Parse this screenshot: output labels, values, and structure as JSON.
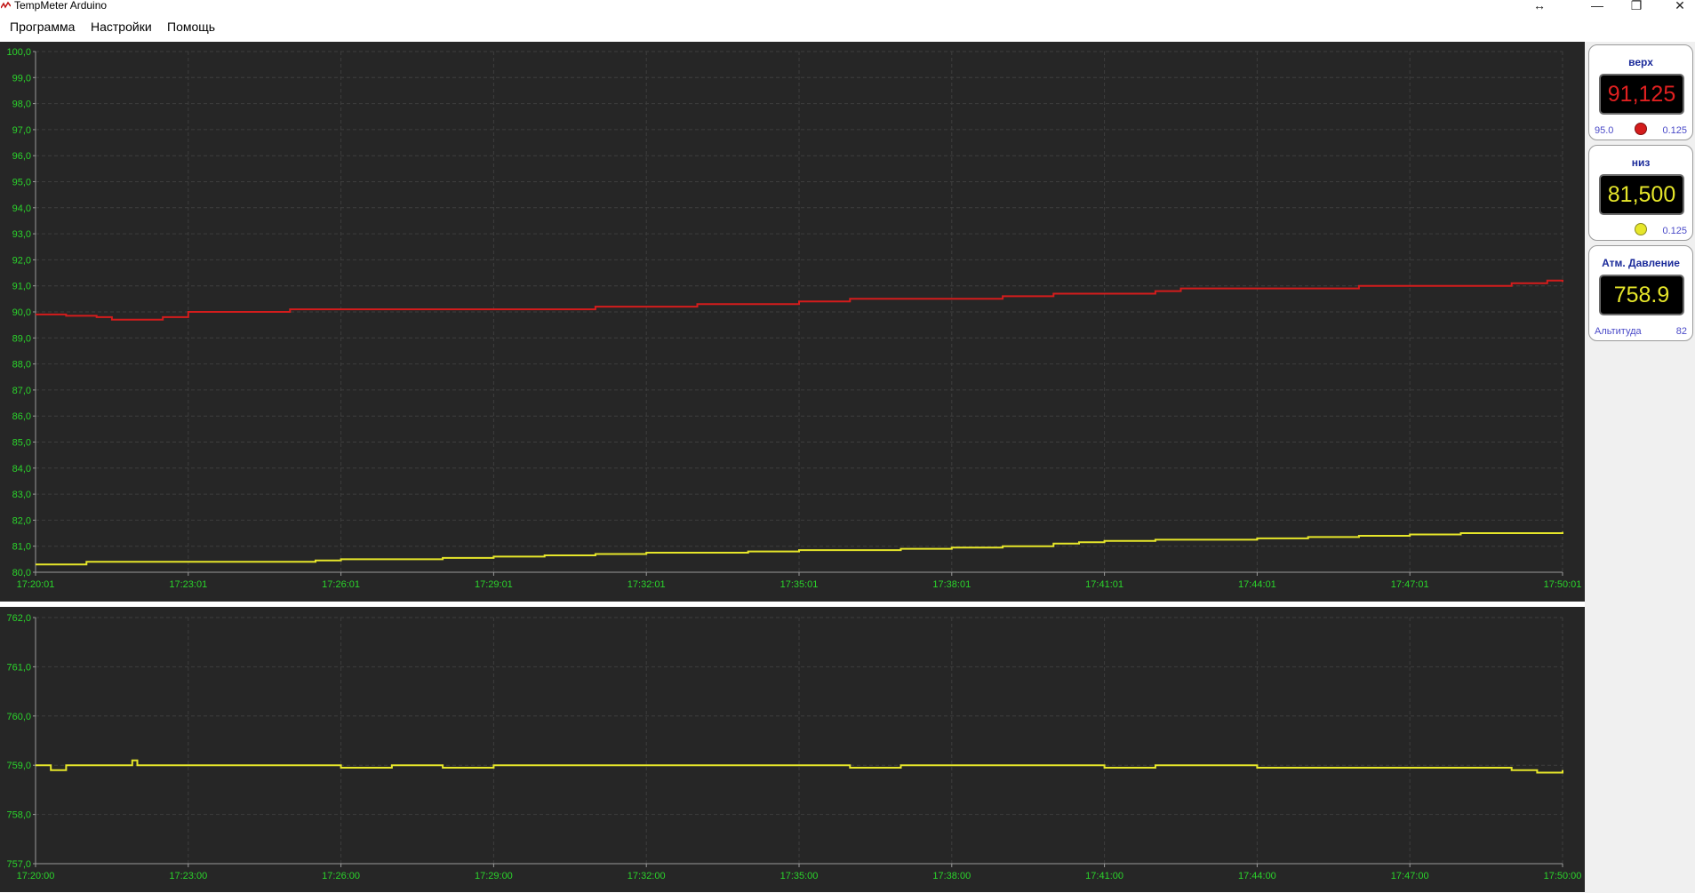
{
  "window": {
    "title": "TempMeter Arduino",
    "buttons": [
      "↔",
      "—",
      "❐",
      "✕"
    ]
  },
  "menu": [
    {
      "label": "Программа"
    },
    {
      "label": "Настройки"
    },
    {
      "label": "Помощь"
    }
  ],
  "colors": {
    "plot_bg": "#262626",
    "grid": "#3e3e3e",
    "axis_text": "#2bd42b",
    "upper_series": "#d41c1c",
    "lower_series": "#e6e62a"
  },
  "gauges": {
    "upper": {
      "title": "верх",
      "value": "91,125",
      "left": "95.0",
      "right": "0.125",
      "color": "#e02020",
      "dot": "#d41c1c"
    },
    "lower": {
      "title": "низ",
      "value": "81,500",
      "left": "",
      "right": "0.125",
      "color": "#e6e62a",
      "dot": "#e6e62a"
    },
    "pressure": {
      "title": "Атм. Давление",
      "value": "758.9",
      "left": "Альтитуда",
      "right": "82",
      "color": "#e6e62a"
    }
  },
  "chart_data": [
    {
      "type": "line",
      "ylim": [
        80,
        100
      ],
      "yticks": [
        "100,0",
        "99,0",
        "98,0",
        "97,0",
        "96,0",
        "95,0",
        "94,0",
        "93,0",
        "92,0",
        "91,0",
        "90,0",
        "89,0",
        "88,0",
        "87,0",
        "86,0",
        "85,0",
        "84,0",
        "83,0",
        "82,0",
        "81,0",
        "80,0"
      ],
      "xticks": [
        "17:20:01",
        "17:23:01",
        "17:26:01",
        "17:29:01",
        "17:32:01",
        "17:35:01",
        "17:38:01",
        "17:41:01",
        "17:44:01",
        "17:47:01",
        "17:50:01"
      ],
      "xlim_minutes": [
        0,
        30
      ],
      "series": [
        {
          "color": "#d41c1c",
          "x": [
            0,
            0.6,
            1.2,
            1.5,
            1.8,
            2.5,
            3.0,
            3.5,
            4,
            5,
            6.5,
            7.5,
            9,
            11,
            13,
            15,
            16,
            17,
            18,
            19,
            20,
            21,
            22,
            22.5,
            23,
            24,
            25,
            26,
            27,
            28,
            29,
            29.7,
            30
          ],
          "y": [
            89.9,
            89.85,
            89.8,
            89.7,
            89.7,
            89.8,
            90.0,
            90.0,
            90.0,
            90.1,
            90.1,
            90.1,
            90.1,
            90.2,
            90.3,
            90.4,
            90.5,
            90.5,
            90.5,
            90.6,
            90.7,
            90.7,
            90.8,
            90.9,
            90.9,
            90.9,
            90.9,
            91.0,
            91.0,
            91.0,
            91.1,
            91.2,
            91.15
          ]
        },
        {
          "color": "#e6e62a",
          "x": [
            0,
            0.5,
            1,
            5.5,
            6,
            8,
            9,
            10,
            11,
            12,
            14,
            15,
            17,
            18,
            19,
            20,
            20.5,
            21,
            22,
            24,
            25,
            26,
            27,
            28,
            29,
            30
          ],
          "y": [
            80.3,
            80.3,
            80.4,
            80.45,
            80.5,
            80.55,
            80.6,
            80.65,
            80.7,
            80.75,
            80.8,
            80.85,
            80.9,
            80.95,
            81.0,
            81.1,
            81.15,
            81.2,
            81.25,
            81.3,
            81.35,
            81.4,
            81.45,
            81.5,
            81.5,
            81.55
          ]
        }
      ]
    },
    {
      "type": "line",
      "ylim": [
        757,
        762
      ],
      "yticks": [
        "762,0",
        "761,0",
        "760,0",
        "759,0",
        "758,0",
        "757,0"
      ],
      "xticks": [
        "17:20:00",
        "17:23:00",
        "17:26:00",
        "17:29:00",
        "17:32:00",
        "17:35:00",
        "17:38:00",
        "17:41:00",
        "17:44:00",
        "17:47:00",
        "17:50:00"
      ],
      "xlim_minutes": [
        0,
        30
      ],
      "series": [
        {
          "color": "#e6e62a",
          "x": [
            0,
            0.3,
            0.6,
            1,
            1.8,
            1.9,
            2,
            2.7,
            5,
            6,
            7,
            8,
            9,
            10,
            11,
            13,
            15,
            16,
            17,
            18,
            20,
            21,
            22,
            23,
            24,
            25,
            26,
            27,
            28,
            29,
            29.5,
            30
          ],
          "y": [
            759.0,
            758.9,
            759.0,
            759.0,
            759.0,
            759.1,
            759.0,
            759.0,
            759.0,
            758.95,
            759.0,
            758.95,
            759.0,
            759.0,
            759.0,
            759.0,
            759.0,
            758.95,
            759.0,
            759.0,
            759.0,
            758.95,
            759.0,
            759.0,
            758.95,
            758.95,
            758.95,
            758.95,
            758.95,
            758.9,
            758.85,
            758.9
          ]
        }
      ]
    }
  ]
}
